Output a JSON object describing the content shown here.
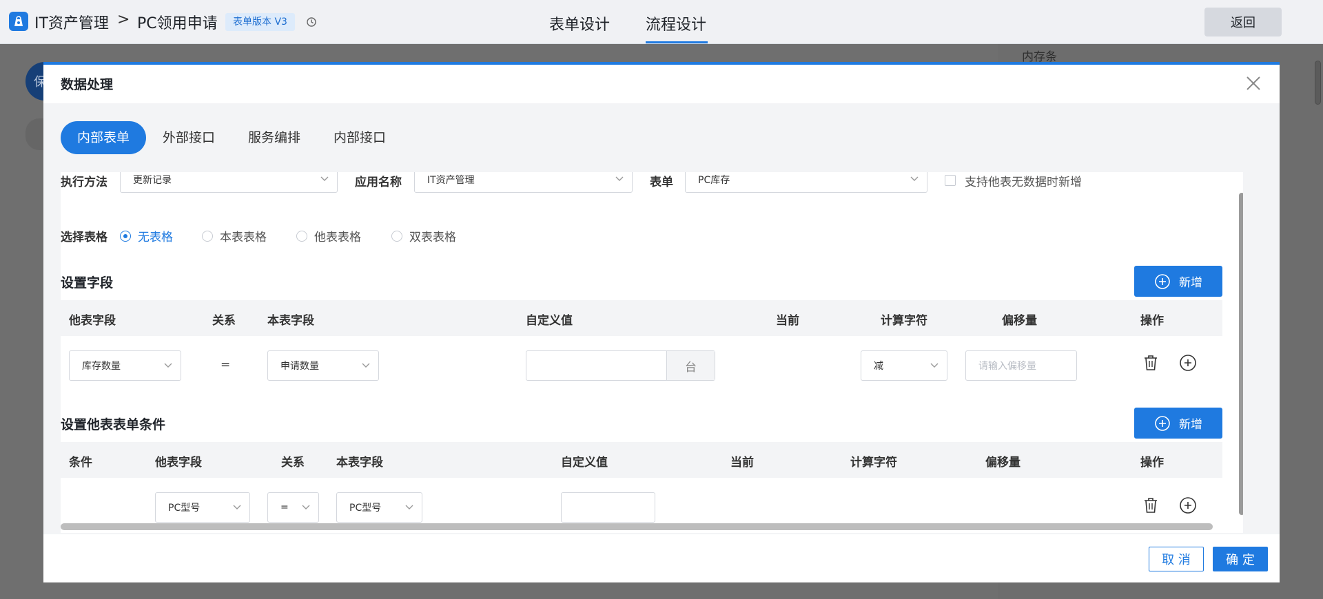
{
  "header": {
    "logo_icon": "bag-icon",
    "app_name": "IT资产管理",
    "separator": ">",
    "page_name": "PC领用申请",
    "version_tag": "表单版本 V3",
    "tabs": [
      "表单设计",
      "流程设计"
    ],
    "active_tab": "流程设计",
    "back_label": "返回"
  },
  "background": {
    "side_text": "内存条",
    "circle_text": "保"
  },
  "dialog": {
    "title": "数据处理",
    "tabs": [
      "内部表单",
      "外部接口",
      "服务编排",
      "内部接口"
    ],
    "active_tab": "内部表单",
    "execute_label": "执行方法",
    "execute_value": "更新记录",
    "app_label": "应用名称",
    "app_value": "IT资产管理",
    "form_label": "表单",
    "form_value": "PC库存",
    "support_label": "支持他表无数据时新增",
    "table_select_label": "选择表格",
    "table_options": [
      "无表格",
      "本表表格",
      "他表表格",
      "双表表格"
    ],
    "table_selected": "无表格",
    "fields_section": {
      "title": "设置字段",
      "add_label": "新增",
      "columns": [
        "他表字段",
        "关系",
        "本表字段",
        "自定义值",
        "当前",
        "计算字符",
        "偏移量",
        "操作"
      ],
      "row": {
        "other_field": "库存数量",
        "relation": "=",
        "this_field": "申请数量",
        "custom_value": "",
        "unit": "台",
        "calc_char": "减",
        "offset_placeholder": "请输入偏移量"
      }
    },
    "conditions_section": {
      "title": "设置他表表单条件",
      "add_label": "新增",
      "columns": [
        "条件",
        "他表字段",
        "关系",
        "本表字段",
        "自定义值",
        "当前",
        "计算字符",
        "偏移量",
        "操作"
      ],
      "row": {
        "other_field": "PC型号",
        "relation": "=",
        "this_field": "PC型号",
        "custom_value": ""
      }
    },
    "cancel_label": "取 消",
    "confirm_label": "确 定"
  },
  "colors": {
    "primary": "#1f7ae0"
  }
}
